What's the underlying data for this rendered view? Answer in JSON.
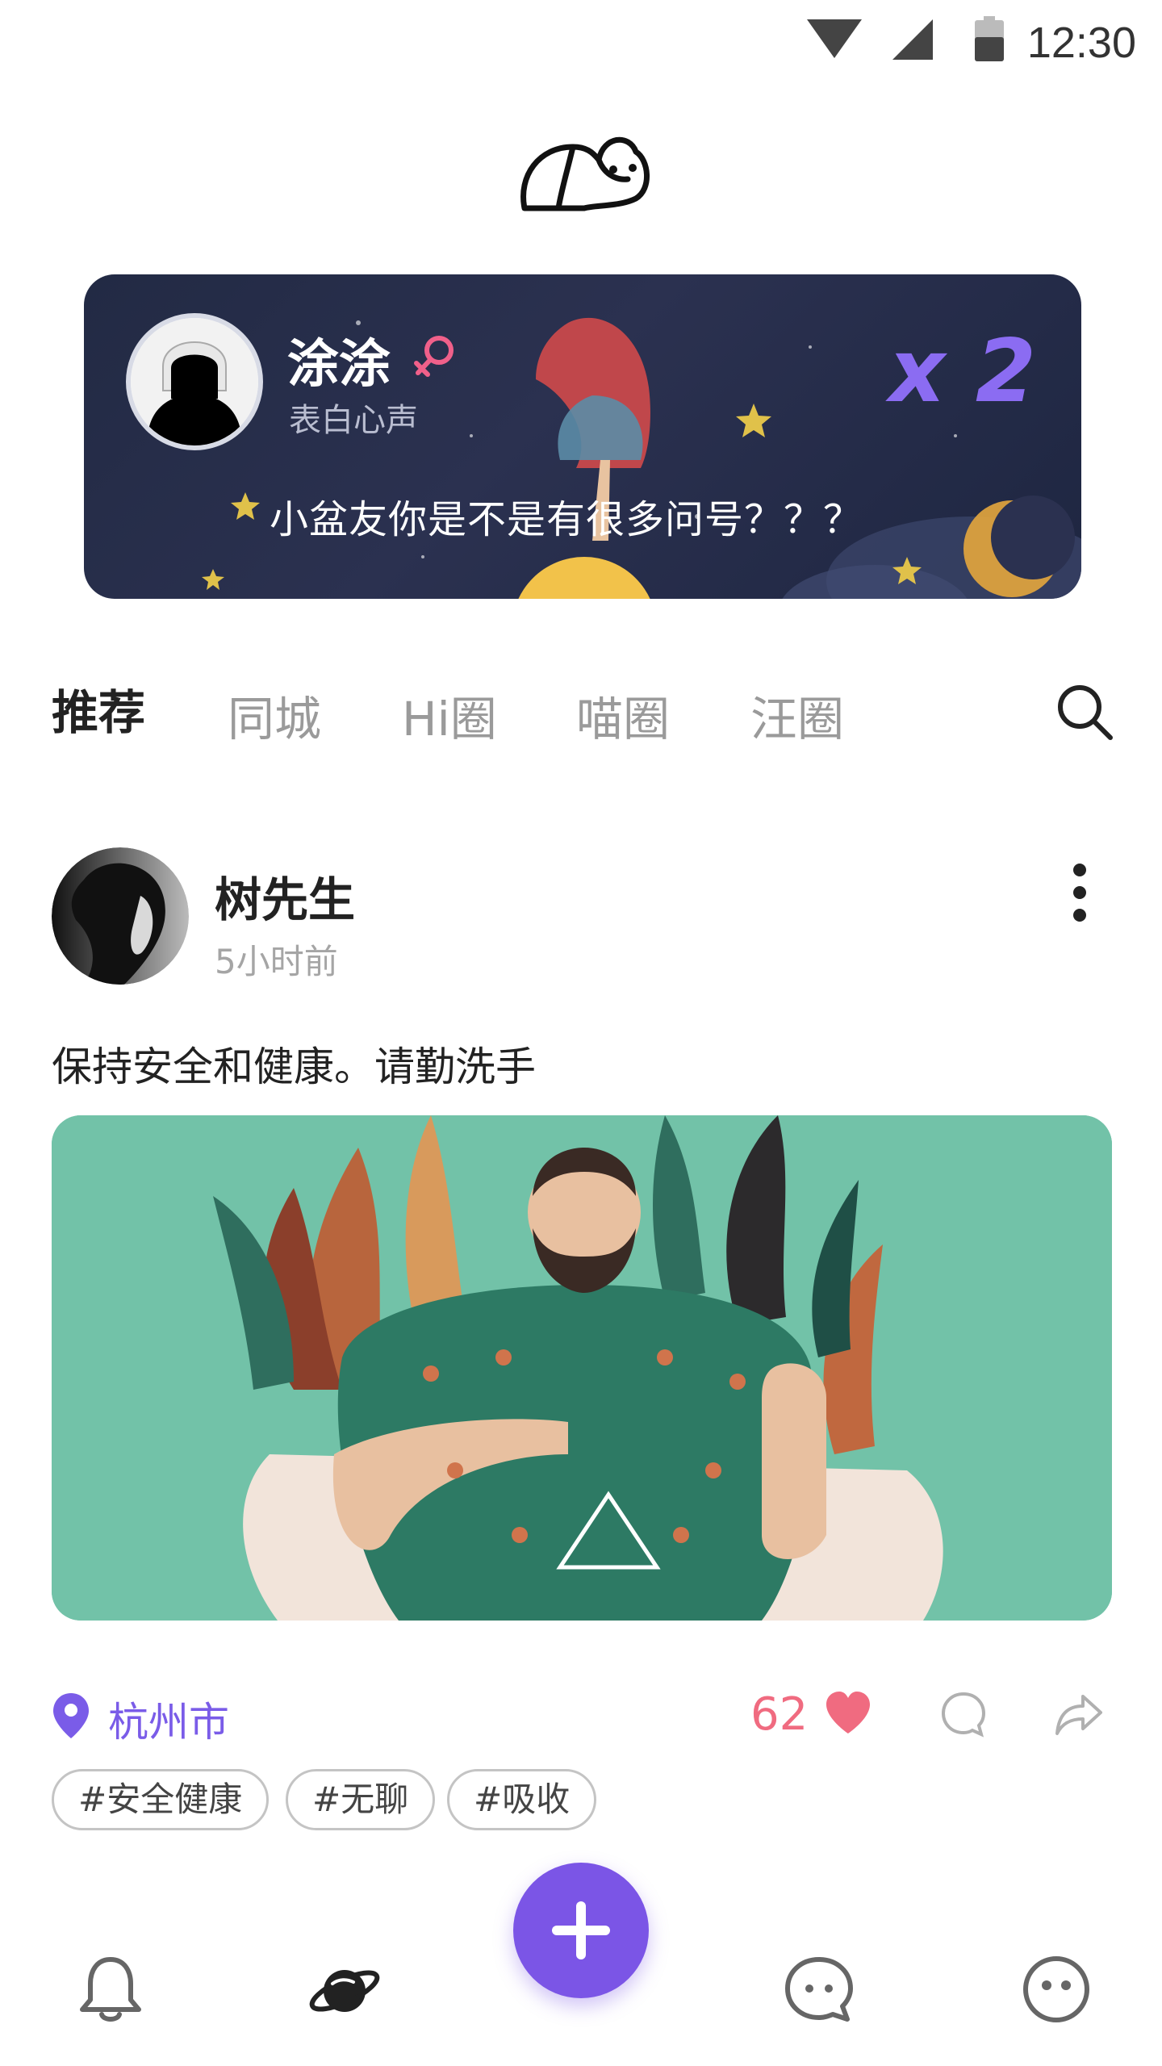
{
  "status_bar": {
    "time": "12:30"
  },
  "banner": {
    "name": "涂涂",
    "subtitle": "表白心声",
    "multiplier": "x 2",
    "message": "小盆友你是不是有很多问号？？？",
    "accent_color": "#8b6cf2",
    "gender_icon": "female-icon"
  },
  "tabs": [
    {
      "label": "推荐",
      "active": true
    },
    {
      "label": "同城",
      "active": false
    },
    {
      "label": "Hi圈",
      "active": false
    },
    {
      "label": "喵圈",
      "active": false
    },
    {
      "label": "汪圈",
      "active": false
    }
  ],
  "post": {
    "author": "树先生",
    "time": "5小时前",
    "text": "保持安全和健康。请勤洗手",
    "location": "杭州市",
    "likes": "62",
    "tags": [
      "#安全健康",
      "#无聊",
      "#吸收"
    ]
  },
  "colors": {
    "primary": "#7b55e6",
    "like": "#f06b80",
    "location": "#7a5ce8"
  },
  "bottom_nav": [
    "bell-icon",
    "planet-icon",
    "add-icon",
    "chat-icon",
    "smiley-icon"
  ]
}
